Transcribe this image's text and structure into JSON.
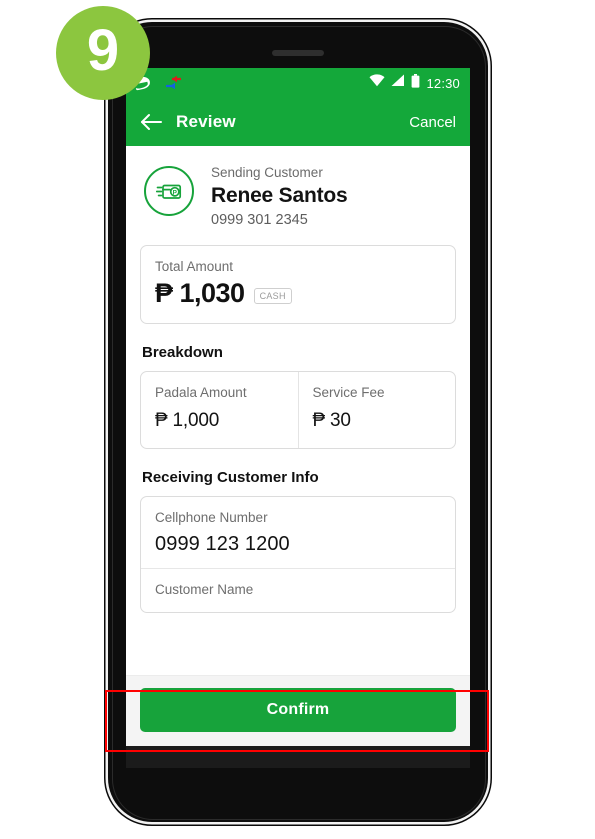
{
  "step_badge": {
    "number": "9"
  },
  "colors": {
    "brand_green": "#14a83a",
    "button_green": "#17a33b",
    "badge_green": "#8cc63f",
    "annotation_red": "#ff0000"
  },
  "status_bar": {
    "time": "12:30",
    "icons": [
      "leaf-icon",
      "data-transfer-icon",
      "wifi-icon",
      "signal-icon",
      "battery-icon"
    ]
  },
  "app_bar": {
    "back_icon": "back-arrow-icon",
    "title": "Review",
    "action_label": "Cancel"
  },
  "sender": {
    "avatar_icon": "money-card-icon",
    "label": "Sending Customer",
    "name": "Renee Santos",
    "phone": "0999 301 2345"
  },
  "total": {
    "label": "Total Amount",
    "value": "₱ 1,030",
    "badge": "CASH"
  },
  "breakdown": {
    "title": "Breakdown",
    "items": [
      {
        "label": "Padala Amount",
        "value": "₱ 1,000"
      },
      {
        "label": "Service Fee",
        "value": "₱ 30"
      }
    ]
  },
  "receiving": {
    "title": "Receiving Customer Info",
    "fields": [
      {
        "label": "Cellphone Number",
        "value": "0999 123 1200"
      },
      {
        "label": "Customer Name",
        "value": ""
      }
    ]
  },
  "footer": {
    "confirm_label": "Confirm"
  }
}
